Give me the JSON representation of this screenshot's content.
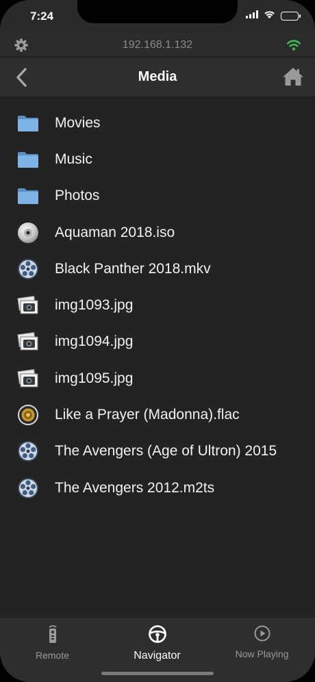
{
  "status_bar": {
    "time": "7:24"
  },
  "host_bar": {
    "ip": "192.168.1.132",
    "settings_icon": "gear-icon",
    "connection_icon": "wifi-icon",
    "connection_color": "#3fb950"
  },
  "nav_bar": {
    "title": "Media",
    "back_icon": "chevron-left-icon",
    "home_icon": "home-icon"
  },
  "files": [
    {
      "name": "Movies",
      "icon": "folder-icon"
    },
    {
      "name": "Music",
      "icon": "folder-icon"
    },
    {
      "name": "Photos",
      "icon": "folder-icon"
    },
    {
      "name": "Aquaman 2018.iso",
      "icon": "disc-icon"
    },
    {
      "name": "Black Panther 2018.mkv",
      "icon": "video-reel-icon"
    },
    {
      "name": "img1093.jpg",
      "icon": "photo-icon"
    },
    {
      "name": "img1094.jpg",
      "icon": "photo-icon"
    },
    {
      "name": "img1095.jpg",
      "icon": "photo-icon"
    },
    {
      "name": "Like a Prayer (Madonna).flac",
      "icon": "speaker-icon"
    },
    {
      "name": "The Avengers (Age of Ultron) 2015",
      "icon": "video-reel-icon"
    },
    {
      "name": "The Avengers 2012.m2ts",
      "icon": "video-reel-icon"
    }
  ],
  "tab_bar": {
    "tabs": [
      {
        "label": "Remote",
        "icon": "remote-icon",
        "active": false
      },
      {
        "label": "Navigator",
        "icon": "steering-wheel-icon",
        "active": true
      },
      {
        "label": "Now Playing",
        "icon": "play-circle-icon",
        "active": false
      }
    ]
  }
}
